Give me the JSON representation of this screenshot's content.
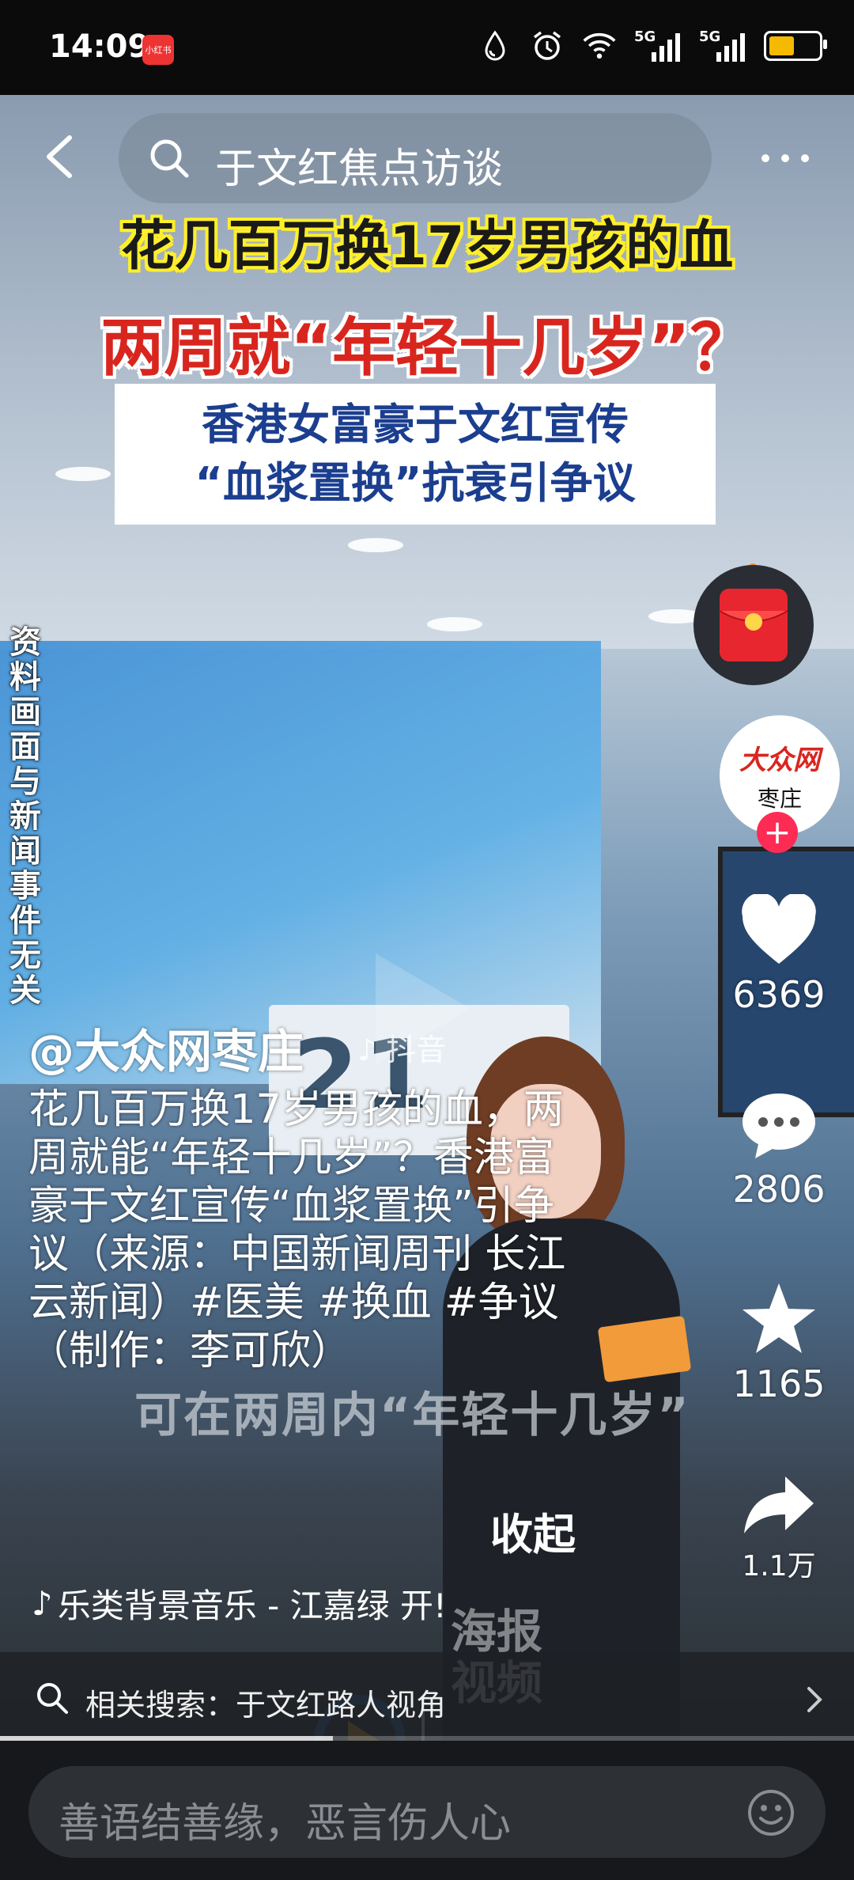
{
  "status_bar": {
    "time": "14:09",
    "app_badge": "小红书",
    "network_1": "5G",
    "network_2": "5G",
    "battery_level": 0.45,
    "battery_color": "#f5b900"
  },
  "top_nav": {
    "back_icon": "chevron-left-icon",
    "search_text": "于文红焦点访谈",
    "more_icon": "more-dots-icon"
  },
  "video_overlay": {
    "headline_1": "花几百万换17岁男孩的血",
    "headline_2": "两周就“年轻十几岁”？",
    "headline_box_line_1": "香港女富豪于文红宣传",
    "headline_box_line_2": "“血浆置换”抗衰引争议",
    "side_note": "资料画面与新闻事件无关",
    "sign_text": "21",
    "burned_subtitle": "可在两周内“年轻十几岁”",
    "watermark_line_1": "海报",
    "watermark_line_2": "视频"
  },
  "right_rail": {
    "red_packet_icon": "red-packet-icon",
    "avatar_logo": "大众网",
    "avatar_sub": "枣庄",
    "follow_label": "+",
    "like_count": "6369",
    "comment_count": "2806",
    "favorite_count": "1165",
    "share_count": "1.1万"
  },
  "caption": {
    "author": "@大众网枣庄",
    "platform_tag": "抖音",
    "text": "花几百万换17岁男孩的血，两周就能“年轻十几岁”？香港富豪于文红宣传“血浆置换”引争议（来源：中国新闻周刊 长江云新闻）#医美 #换血 #争议 （制作：李可欣）",
    "collapse_label": "收起",
    "music": "乐类背景音乐 - 江嘉绿   开!"
  },
  "related_search": {
    "label": "相关搜索：于文红路人视角"
  },
  "progress": {
    "played_fraction": 0.39
  },
  "comment_bar": {
    "placeholder": "善语结善缘，恶言伤人心",
    "emoji_icon": "emoji-smile-icon"
  },
  "colors": {
    "headline_yellow": "#ffef2a",
    "headline_red": "#d8261f",
    "box_blue": "#1b3e8f",
    "follow_pink": "#fe2c55"
  }
}
